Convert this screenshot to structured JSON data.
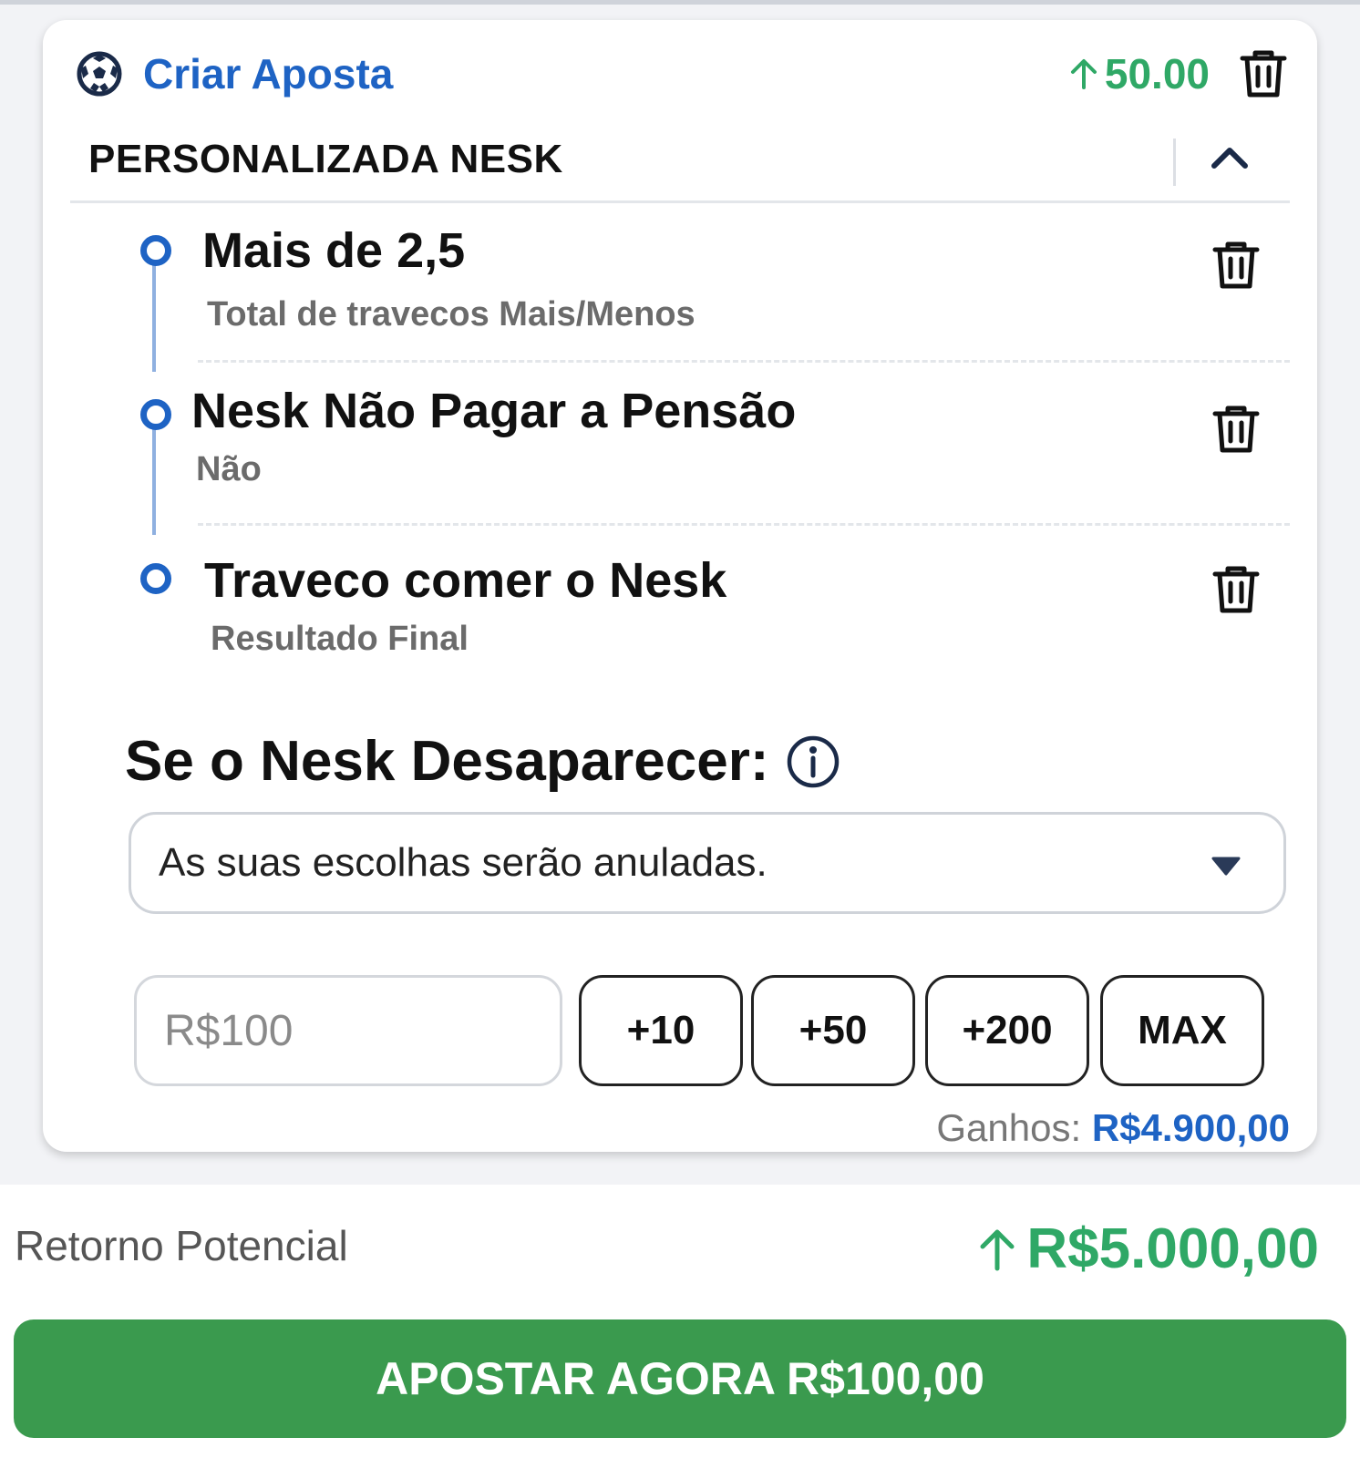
{
  "header": {
    "title": "Criar Aposta",
    "subtitle": "PERSONALIZADA NESK",
    "odds": "50.00",
    "accent_color": "#1e63c4",
    "odds_color": "#2fa866"
  },
  "selections": [
    {
      "title": "Mais de 2,5",
      "subtitle": "Total de travecos Mais/Menos"
    },
    {
      "title": "Nesk Não Pagar a Pensão",
      "subtitle": "Não"
    },
    {
      "title": "Traveco comer o Nesk",
      "subtitle": "Resultado Final"
    }
  ],
  "void_rule": {
    "label": "Se o Nesk Desaparecer:",
    "selected": "As suas escolhas serão anuladas."
  },
  "stake": {
    "placeholder": "R$100",
    "quick_buttons": [
      "+10",
      "+50",
      "+200",
      "MAX"
    ],
    "winnings_label": "Ganhos:",
    "winnings_value": "R$4.900,00"
  },
  "footer": {
    "return_label": "Retorno Potencial",
    "return_value": "R$5.000,00",
    "cta_label": "APOSTAR AGORA R$100,00",
    "cta_color": "#3a9a4e"
  },
  "icons": [
    "soccer-ball-icon",
    "arrow-up-icon",
    "trash-icon",
    "chevron-up-icon",
    "info-icon",
    "caret-down-icon"
  ]
}
